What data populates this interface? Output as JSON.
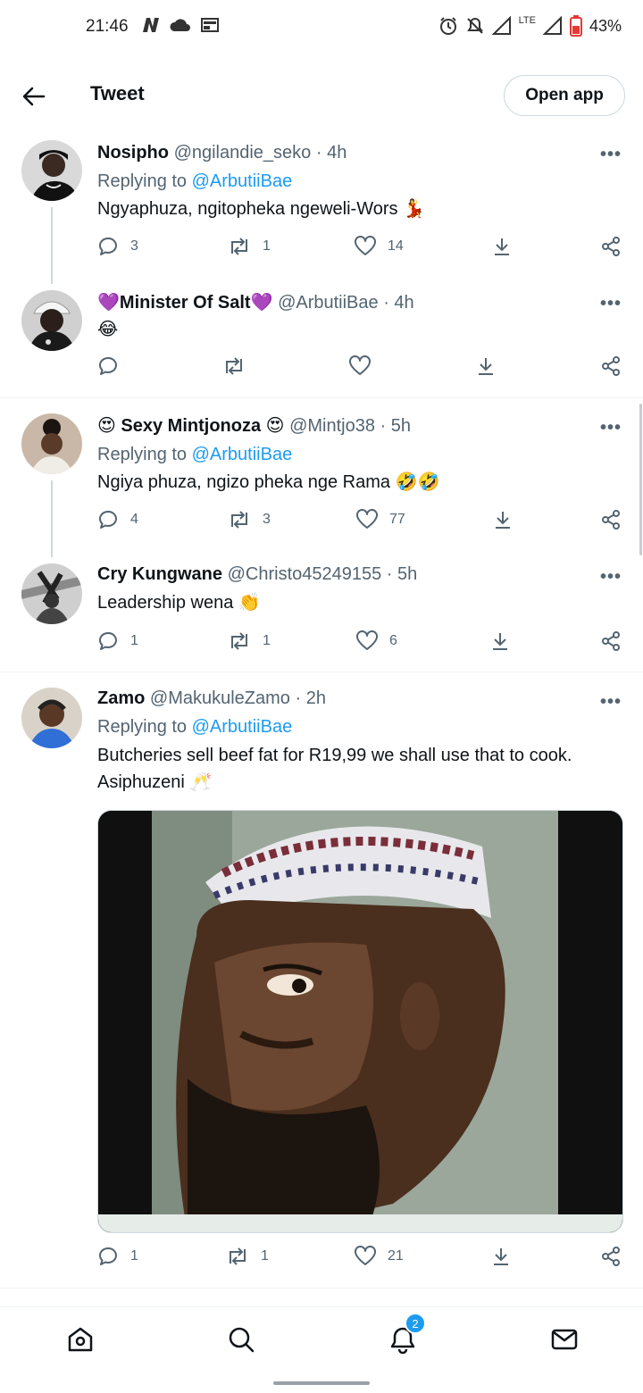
{
  "status_bar": {
    "time": "21:46",
    "battery": "43%",
    "network": "LTE"
  },
  "header": {
    "title": "Tweet",
    "open_app_label": "Open app"
  },
  "tweets": [
    {
      "name": "Nosipho",
      "handle": "@ngilandie_seko · 4h",
      "replying_prefix": "Replying to ",
      "replying_to": "@ArbutiiBae",
      "text": "Ngyaphuza, ngitopheka ngeweli-Wors 💃",
      "replies": "3",
      "retweets": "1",
      "likes": "14"
    },
    {
      "name": "💜Minister Of Salt💜",
      "handle": "@ArbutiiBae · 4h",
      "text": "😂",
      "replies": "",
      "retweets": "",
      "likes": ""
    },
    {
      "name": "😍 Sexy Mintjonoza 😍",
      "handle": "@Mintjo38 · 5h",
      "replying_prefix": "Replying to ",
      "replying_to": "@ArbutiiBae",
      "text": "Ngiya phuza, ngizo pheka nge Rama 🤣🤣",
      "replies": "4",
      "retweets": "3",
      "likes": "77"
    },
    {
      "name": "Cry Kungwane",
      "handle": "@Christo45249155 · 5h",
      "text": "Leadership wena 👏",
      "replies": "1",
      "retweets": "1",
      "likes": "6"
    },
    {
      "name": "Zamo",
      "handle": "@MakukuleZamo · 2h",
      "replying_prefix": "Replying to ",
      "replying_to": "@ArbutiiBae",
      "text": "Butcheries sell beef fat for R19,99 we shall use that to cook. Asiphuzeni 🥂",
      "replies": "1",
      "retweets": "1",
      "likes": "21"
    }
  ],
  "more_glyph": "•••",
  "bottom_nav": {
    "notifications_badge": "2"
  },
  "colors": {
    "accent": "#1d9bf0",
    "text": "#0f1419",
    "muted": "#536471"
  }
}
